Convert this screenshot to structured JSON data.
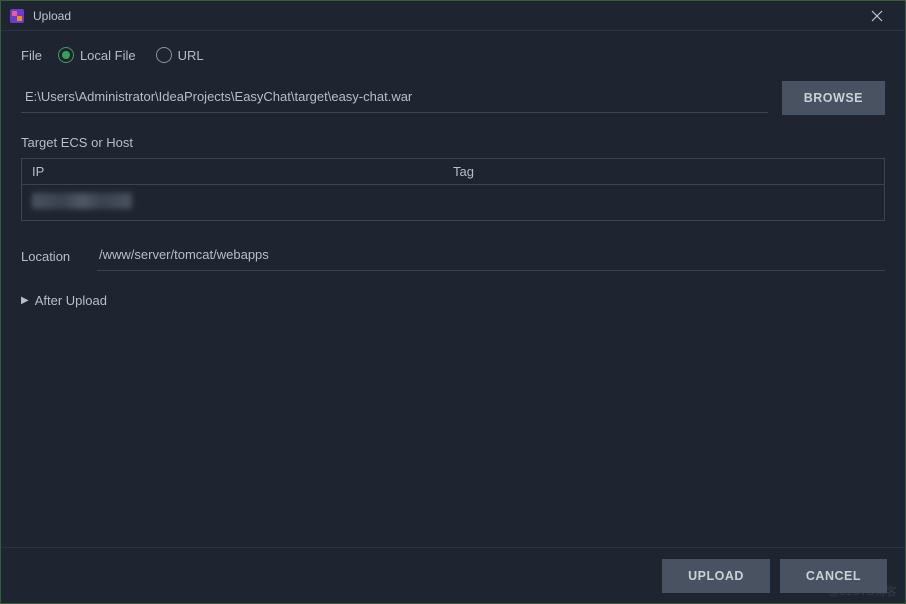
{
  "titlebar": {
    "title": "Upload"
  },
  "file": {
    "label": "File",
    "radio_local": "Local File",
    "radio_url": "URL",
    "selected": "local",
    "path": "E:\\Users\\Administrator\\IdeaProjects\\EasyChat\\target\\easy-chat.war",
    "browse_label": "BROWSE"
  },
  "target": {
    "label": "Target ECS or Host",
    "columns": {
      "ip": "IP",
      "tag": "Tag"
    },
    "rows": [
      {
        "ip": "",
        "tag": ""
      }
    ]
  },
  "location": {
    "label": "Location",
    "value": "/www/server/tomcat/webapps"
  },
  "after_upload": {
    "label": "After Upload"
  },
  "footer": {
    "upload": "UPLOAD",
    "cancel": "CANCEL"
  },
  "watermark": "@51CTO博客"
}
